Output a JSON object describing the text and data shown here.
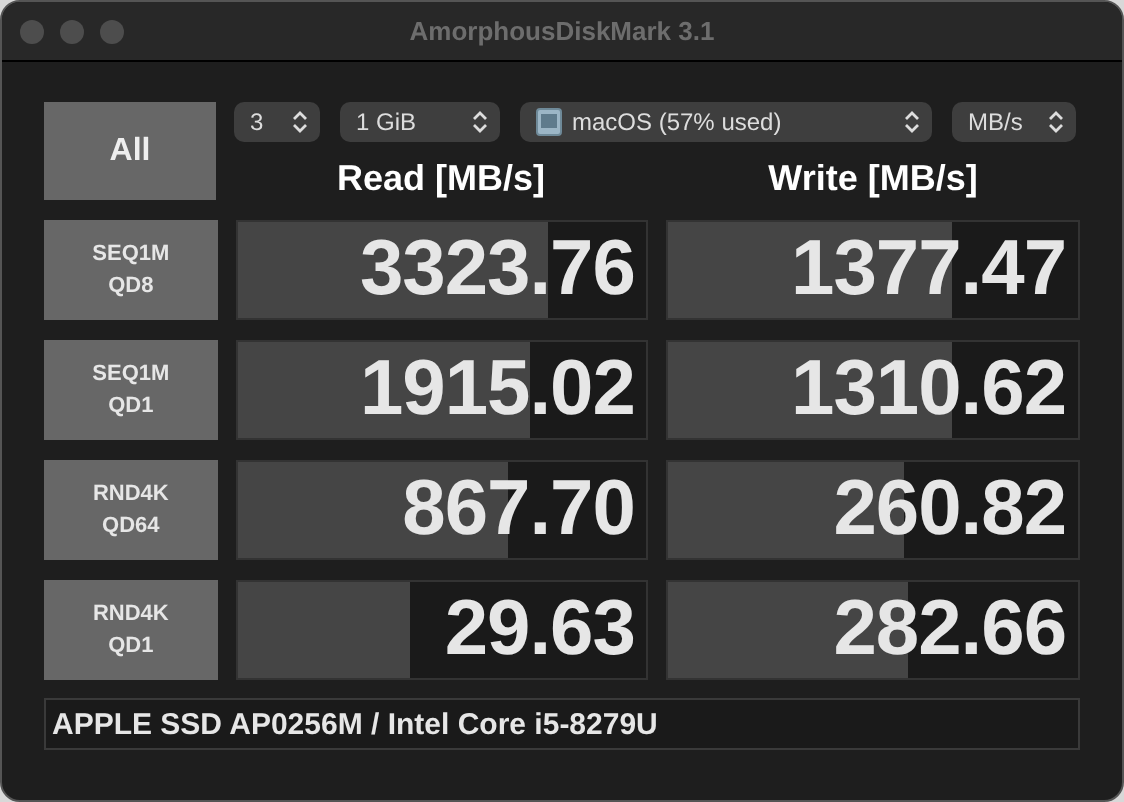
{
  "window": {
    "title": "AmorphousDiskMark 3.1"
  },
  "all_button": "All",
  "selects": [
    {
      "kind": "plain",
      "value": "3"
    },
    {
      "kind": "plain",
      "value": "1 GiB"
    },
    {
      "kind": "disk",
      "value": "macOS (57% used)"
    },
    {
      "kind": "plain",
      "value": "MB/s"
    }
  ],
  "headers": [
    "Read [MB/s]",
    "Write [MB/s]"
  ],
  "tests": [
    {
      "label": [
        "SEQ1M",
        "QD8"
      ],
      "read": {
        "value": "3323.76",
        "level": 0.76
      },
      "write": {
        "value": "1377.47",
        "level": 0.69
      }
    },
    {
      "label": [
        "SEQ1M",
        "QD1"
      ],
      "read": {
        "value": "1915.02",
        "level": 0.715
      },
      "write": {
        "value": "1310.62",
        "level": 0.69
      }
    },
    {
      "label": [
        "RND4K",
        "QD64"
      ],
      "read": {
        "value": "867.70",
        "level": 0.66
      },
      "write": {
        "value": "260.82",
        "level": 0.575
      }
    },
    {
      "label": [
        "RND4K",
        "QD1"
      ],
      "read": {
        "value": "29.63",
        "level": 0.42
      },
      "write": {
        "value": "282.66",
        "level": 0.585
      }
    }
  ],
  "status_bar": "APPLE SSD AP0256M / Intel Core i5-8279U"
}
